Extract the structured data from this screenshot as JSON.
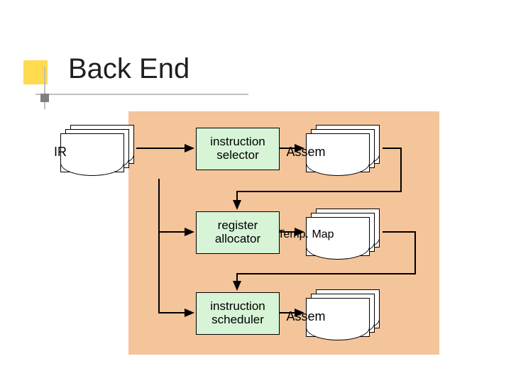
{
  "title": "Back End",
  "nodes": {
    "ir": "IR",
    "instruction_selector": "instruction\nselector",
    "register_allocator": "register\nallocator",
    "instruction_scheduler": "instruction\nscheduler",
    "assem1": "Assem",
    "tempmap": "Temp. Map",
    "assem2": "Assem"
  },
  "colors": {
    "accent_yellow": "#ffdb4d",
    "peach": "#f4c49a",
    "proc_fill": "#d7f4d7"
  }
}
